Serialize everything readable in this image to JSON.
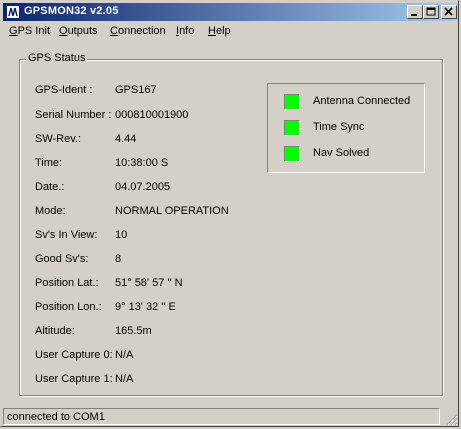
{
  "window": {
    "title": "GPSMON32 v2.05",
    "title_color": "#0a246a"
  },
  "menu": {
    "items": [
      {
        "label": "GPS Init",
        "accel": "G",
        "rest": "PS Init"
      },
      {
        "label": "Outputs",
        "accel": "O",
        "rest": "utputs"
      },
      {
        "label": "Connection",
        "accel": "C",
        "rest": "onnection"
      },
      {
        "label": "Info",
        "accel": "I",
        "rest": "nfo"
      },
      {
        "label": "Help",
        "accel": "H",
        "rest": "elp"
      }
    ]
  },
  "status_group": {
    "title": "GPS Status",
    "fields": [
      {
        "label": "GPS-Ident :",
        "value": "GPS167"
      },
      {
        "label": "Serial Number :",
        "value": "000810001900"
      },
      {
        "label": "SW-Rev.:",
        "value": "4.44"
      },
      {
        "label": "Time:",
        "value": "10:38:00 S"
      },
      {
        "label": "Date.:",
        "value": "04.07.2005"
      },
      {
        "label": "Mode:",
        "value": "NORMAL OPERATION"
      },
      {
        "label": "Sv's In View:",
        "value": "10"
      },
      {
        "label": "Good Sv's:",
        "value": "8"
      },
      {
        "label": "Position Lat.:",
        "value": "51° 58' 57 '' N"
      },
      {
        "label": "Position Lon.:",
        "value": "9° 13' 32 '' E"
      },
      {
        "label": "Altitude:",
        "value": "165.5m"
      },
      {
        "label": "User Capture 0:",
        "value": "N/A"
      },
      {
        "label": "User Capture 1:",
        "value": "N/A"
      }
    ],
    "indicators": [
      {
        "label": "Antenna Connected",
        "state": "on",
        "color": "#00ff00"
      },
      {
        "label": "Time Sync",
        "state": "on",
        "color": "#00ff00"
      },
      {
        "label": "Nav Solved",
        "state": "on",
        "color": "#00ff00"
      }
    ]
  },
  "statusbar": {
    "text": "connected to COM1"
  },
  "icons": {
    "app": "gpsmon-app-icon",
    "minimize": "minimize-icon",
    "maximize": "maximize-icon",
    "close": "close-icon",
    "grip": "resize-grip-icon"
  }
}
